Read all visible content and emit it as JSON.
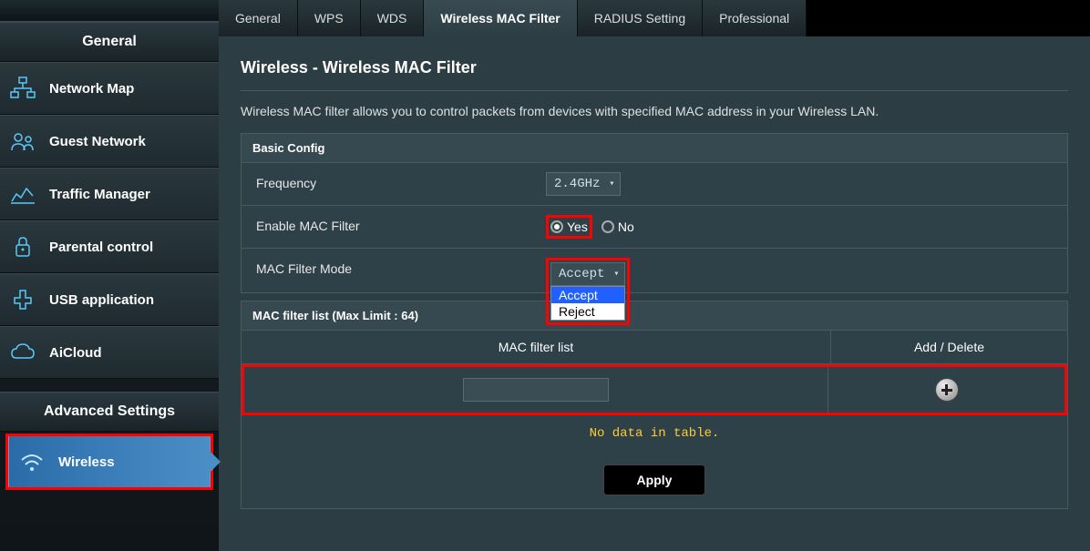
{
  "sidebar": {
    "general_header": "General",
    "advanced_header": "Advanced Settings",
    "items": [
      {
        "label": "Network Map"
      },
      {
        "label": "Guest Network"
      },
      {
        "label": "Traffic Manager"
      },
      {
        "label": "Parental control"
      },
      {
        "label": "USB application"
      },
      {
        "label": "AiCloud"
      }
    ],
    "advanced_items": [
      {
        "label": "Wireless"
      }
    ]
  },
  "tabs": {
    "items": [
      "General",
      "WPS",
      "WDS",
      "Wireless MAC Filter",
      "RADIUS Setting",
      "Professional"
    ],
    "active": "Wireless MAC Filter"
  },
  "page": {
    "title": "Wireless - Wireless MAC Filter",
    "description": "Wireless MAC filter allows you to control packets from devices with specified MAC address in your Wireless LAN."
  },
  "basic_config": {
    "header": "Basic Config",
    "frequency_label": "Frequency",
    "frequency_value": "2.4GHz",
    "enable_label": "Enable MAC Filter",
    "enable_yes": "Yes",
    "enable_no": "No",
    "mode_label": "MAC Filter Mode",
    "mode_value": "Accept",
    "mode_options": [
      "Accept",
      "Reject"
    ]
  },
  "mac_table": {
    "header": "MAC filter list (Max Limit : 64)",
    "col_mac": "MAC filter list",
    "col_action": "Add / Delete",
    "no_data": "No data in table."
  },
  "buttons": {
    "apply": "Apply"
  }
}
